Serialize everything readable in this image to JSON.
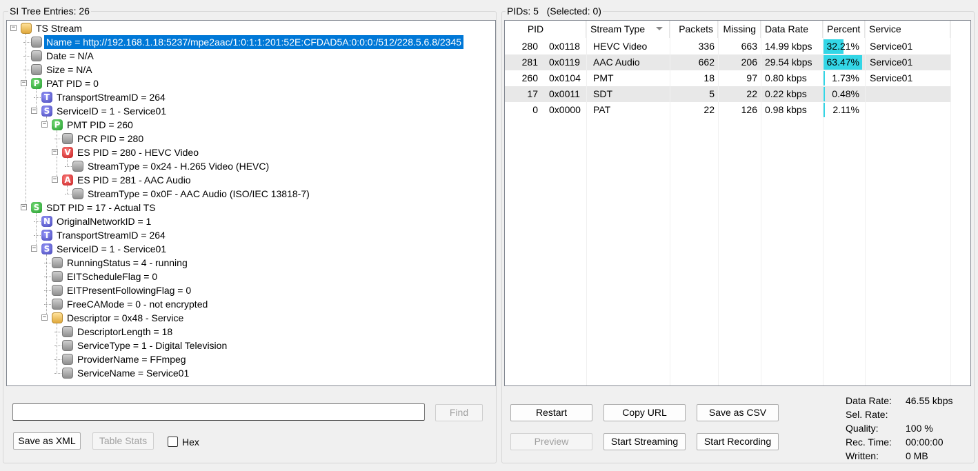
{
  "left": {
    "title": "SI Tree Entries: 26",
    "tree": [
      {
        "depth": 0,
        "icon": "folder",
        "letter": "",
        "label": "TS Stream",
        "toggle": "−",
        "selected": false
      },
      {
        "depth": 1,
        "icon": "leaf",
        "letter": "",
        "label": "Name = http://192.168.1.18:5237/mpe2aac/1:0:1:1:201:52E:CFDAD5A:0:0:0:/512/228.5.6.8/2345",
        "toggle": "",
        "selected": true
      },
      {
        "depth": 1,
        "icon": "leaf",
        "letter": "",
        "label": "Date = N/A",
        "toggle": "",
        "selected": false
      },
      {
        "depth": 1,
        "icon": "leaf",
        "letter": "",
        "label": "Size = N/A",
        "toggle": "",
        "selected": false
      },
      {
        "depth": 1,
        "icon": "P",
        "letter": "P",
        "label": "PAT PID = 0",
        "toggle": "−",
        "selected": false
      },
      {
        "depth": 2,
        "icon": "T",
        "letter": "T",
        "label": "TransportStreamID = 264",
        "toggle": "",
        "selected": false
      },
      {
        "depth": 2,
        "icon": "S",
        "letter": "S",
        "label": "ServiceID = 1 - Service01",
        "toggle": "−",
        "selected": false
      },
      {
        "depth": 3,
        "icon": "P",
        "letter": "P",
        "label": "PMT PID = 260",
        "toggle": "−",
        "selected": false
      },
      {
        "depth": 4,
        "icon": "leaf",
        "letter": "",
        "label": "PCR PID = 280",
        "toggle": "",
        "selected": false
      },
      {
        "depth": 4,
        "icon": "V",
        "letter": "V",
        "label": "ES PID = 280 - HEVC Video",
        "toggle": "−",
        "selected": false
      },
      {
        "depth": 5,
        "icon": "leaf",
        "letter": "",
        "label": "StreamType = 0x24 - H.265 Video (HEVC)",
        "toggle": "",
        "selected": false
      },
      {
        "depth": 4,
        "icon": "A",
        "letter": "A",
        "label": "ES PID = 281 - AAC Audio",
        "toggle": "−",
        "selected": false
      },
      {
        "depth": 5,
        "icon": "leaf",
        "letter": "",
        "label": "StreamType = 0x0F - AAC Audio (ISO/IEC 13818-7)",
        "toggle": "",
        "selected": false
      },
      {
        "depth": 1,
        "icon": "S2",
        "letter": "S",
        "label": "SDT PID = 17 - Actual TS",
        "toggle": "−",
        "selected": false
      },
      {
        "depth": 2,
        "icon": "N",
        "letter": "N",
        "label": "OriginalNetworkID = 1",
        "toggle": "",
        "selected": false
      },
      {
        "depth": 2,
        "icon": "T",
        "letter": "T",
        "label": "TransportStreamID = 264",
        "toggle": "",
        "selected": false
      },
      {
        "depth": 2,
        "icon": "S",
        "letter": "S",
        "label": "ServiceID = 1 - Service01",
        "toggle": "−",
        "selected": false
      },
      {
        "depth": 3,
        "icon": "leaf",
        "letter": "",
        "label": "RunningStatus = 4 - running",
        "toggle": "",
        "selected": false
      },
      {
        "depth": 3,
        "icon": "leaf",
        "letter": "",
        "label": "EITScheduleFlag = 0",
        "toggle": "",
        "selected": false
      },
      {
        "depth": 3,
        "icon": "leaf",
        "letter": "",
        "label": "EITPresentFollowingFlag = 0",
        "toggle": "",
        "selected": false
      },
      {
        "depth": 3,
        "icon": "leaf",
        "letter": "",
        "label": "FreeCAMode = 0 - not encrypted",
        "toggle": "",
        "selected": false
      },
      {
        "depth": 3,
        "icon": "folder",
        "letter": "",
        "label": "Descriptor = 0x48 - Service",
        "toggle": "−",
        "selected": false
      },
      {
        "depth": 4,
        "icon": "leaf",
        "letter": "",
        "label": "DescriptorLength = 18",
        "toggle": "",
        "selected": false
      },
      {
        "depth": 4,
        "icon": "leaf",
        "letter": "",
        "label": "ServiceType = 1 - Digital Television",
        "toggle": "",
        "selected": false
      },
      {
        "depth": 4,
        "icon": "leaf",
        "letter": "",
        "label": "ProviderName = FFmpeg",
        "toggle": "",
        "selected": false
      },
      {
        "depth": 4,
        "icon": "leaf",
        "letter": "",
        "label": "ServiceName = Service01",
        "toggle": "",
        "selected": false
      }
    ],
    "search_value": "",
    "find_label": "Find",
    "save_xml_label": "Save as XML",
    "table_stats_label": "Table Stats",
    "hex_label": "Hex"
  },
  "right": {
    "title": "PIDs: 5   (Selected: 0)",
    "columns": [
      "PID",
      "Stream Type",
      "Packets",
      "Missing",
      "Data Rate",
      "Percent",
      "Service"
    ],
    "rows": [
      {
        "pid": "280",
        "hex": "0x0118",
        "type": "HEVC Video",
        "packets": "336",
        "missing": "663",
        "rate": "14.99 kbps",
        "percent": "32.21%",
        "pct": 32.21,
        "service": "Service01"
      },
      {
        "pid": "281",
        "hex": "0x0119",
        "type": "AAC Audio",
        "packets": "662",
        "missing": "206",
        "rate": "29.54 kbps",
        "percent": "63.47%",
        "pct": 63.47,
        "service": "Service01"
      },
      {
        "pid": "260",
        "hex": "0x0104",
        "type": "PMT",
        "packets": "18",
        "missing": "97",
        "rate": "0.80 kbps",
        "percent": "1.73%",
        "pct": 1.73,
        "service": "Service01"
      },
      {
        "pid": "17",
        "hex": "0x0011",
        "type": "SDT",
        "packets": "5",
        "missing": "22",
        "rate": "0.22 kbps",
        "percent": "0.48%",
        "pct": 0.48,
        "service": ""
      },
      {
        "pid": "0",
        "hex": "0x0000",
        "type": "PAT",
        "packets": "22",
        "missing": "126",
        "rate": "0.98 kbps",
        "percent": "2.11%",
        "pct": 2.11,
        "service": ""
      }
    ],
    "buttons": {
      "restart": "Restart",
      "copy_url": "Copy URL",
      "save_csv": "Save as CSV",
      "preview": "Preview",
      "start_streaming": "Start Streaming",
      "start_recording": "Start Recording"
    },
    "stats": [
      {
        "label": "Data Rate:",
        "value": "46.55 kbps"
      },
      {
        "label": "Sel. Rate:",
        "value": ""
      },
      {
        "label": "Quality:",
        "value": "100 %"
      },
      {
        "label": "Rec. Time:",
        "value": "00:00:00"
      },
      {
        "label": "Written:",
        "value": "0 MB"
      }
    ]
  },
  "colors": {
    "selection": "#0078d7",
    "percent_bar": "#33d6e6",
    "alt_row": "#e8e8e8"
  }
}
